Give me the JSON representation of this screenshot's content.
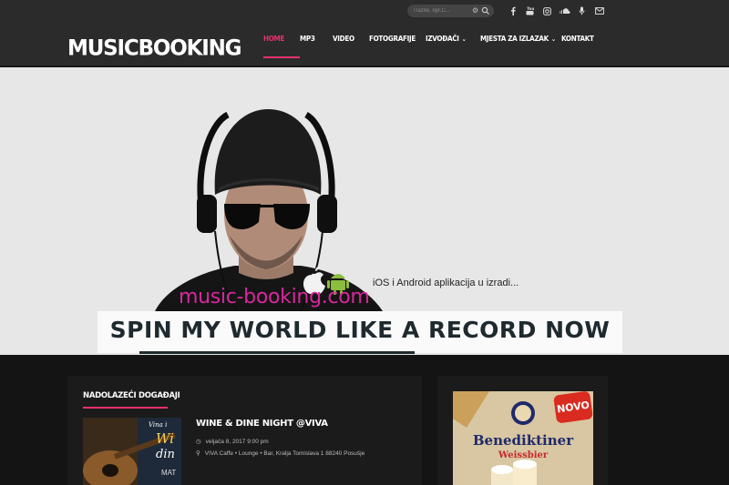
{
  "search": {
    "placeholder": "Tražite, npr.C..."
  },
  "social": [
    "facebook-icon",
    "youtube-icon",
    "instagram-icon",
    "soundcloud-icon",
    "microphone-icon",
    "mail-icon"
  ],
  "logo": "MUSICBOOKING",
  "nav": [
    {
      "label": "HOME",
      "active": true
    },
    {
      "label": "MP3"
    },
    {
      "label": "VIDEO"
    },
    {
      "label": "FOTOGRAFIJE"
    },
    {
      "label": "IZVOĐAČI",
      "dropdown": true
    },
    {
      "label": "MJESTA ZA IZLAZAK",
      "dropdown": true
    },
    {
      "label": "KONTAKT"
    }
  ],
  "hero": {
    "app_note": "iOS i Android aplikacija u izradi...",
    "site_url": "music-booking.com",
    "slogan": "SPIN MY WORLD LIKE A RECORD NOW"
  },
  "events": {
    "title": "NADOLAZEĆI DOGAĐAJI",
    "item": {
      "title": "WINE & DINE NIGHT @VIVA",
      "date": "veljača 8, 2017 9:00 pm",
      "location": "VIVA Caffe • Lounge • Bar, Kralja Tomislava 1 88240 Posušje",
      "thumb_text_1": "Vina i",
      "thumb_text_2": "Wi",
      "thumb_text_3": "din",
      "thumb_text_4": "MAT"
    }
  },
  "ad": {
    "badge": "NOVO",
    "brand": "Benediktiner",
    "sub": "Weissbier"
  },
  "colors": {
    "accent": "#e8306f",
    "header": "#2b2b2b",
    "url_pink": "#d8279c"
  }
}
